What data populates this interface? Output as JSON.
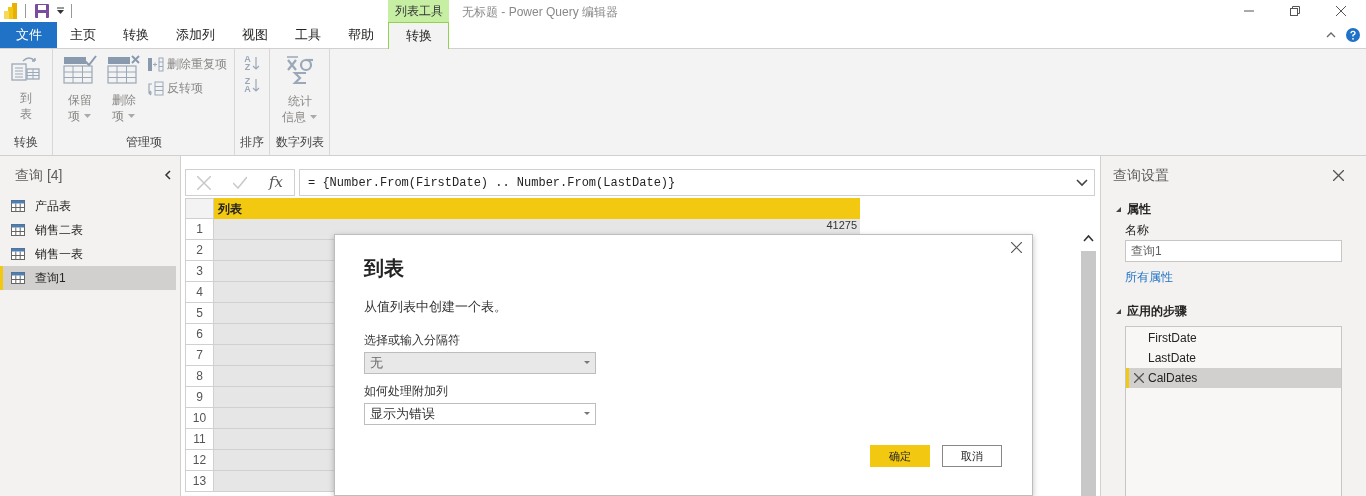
{
  "title_bar": {
    "context_group": "列表工具",
    "title": "无标题 - Power Query 编辑器"
  },
  "ribbon_tabs": [
    {
      "label": "文件",
      "kind": "file",
      "selected": false
    },
    {
      "label": "主页",
      "kind": "normal",
      "selected": false
    },
    {
      "label": "转换",
      "kind": "normal",
      "selected": false
    },
    {
      "label": "添加列",
      "kind": "normal",
      "selected": false
    },
    {
      "label": "视图",
      "kind": "normal",
      "selected": false
    },
    {
      "label": "工具",
      "kind": "normal",
      "selected": false
    },
    {
      "label": "帮助",
      "kind": "normal",
      "selected": false
    },
    {
      "label": "转换",
      "kind": "context",
      "selected": true
    }
  ],
  "ribbon_groups": [
    {
      "label": "转换",
      "buttons": [
        {
          "kind": "large",
          "lines": [
            "到",
            "表"
          ],
          "dropdown": false
        }
      ]
    },
    {
      "label": "管理项",
      "buttons": [
        {
          "kind": "large",
          "lines": [
            "保留",
            "项"
          ],
          "dropdown": true
        },
        {
          "kind": "large",
          "lines": [
            "删除",
            "项"
          ],
          "dropdown": true
        },
        {
          "kind": "small",
          "lines": [
            "删除重复项"
          ],
          "dropdown": false
        },
        {
          "kind": "small",
          "lines": [
            "反转项"
          ],
          "dropdown": false
        }
      ]
    },
    {
      "label": "排序",
      "buttons": [
        {
          "kind": "sort",
          "lines": [
            "A",
            "Z"
          ],
          "dropdown": false
        },
        {
          "kind": "sort",
          "lines": [
            "Z",
            "A"
          ],
          "dropdown": false
        }
      ]
    },
    {
      "label": "数字列表",
      "buttons": [
        {
          "kind": "large",
          "lines": [
            "统计",
            "信息"
          ],
          "dropdown": true
        }
      ]
    }
  ],
  "queries_pane": {
    "title": "查询 [4]",
    "items": [
      {
        "label": "产品表",
        "selected": false
      },
      {
        "label": "销售二表",
        "selected": false
      },
      {
        "label": "销售一表",
        "selected": false
      },
      {
        "label": "查询1",
        "selected": true
      }
    ]
  },
  "formula_bar": {
    "function_label": "fx",
    "formula": "= {Number.From(FirstDate) .. Number.From(LastDate)}"
  },
  "table": {
    "column": "列表",
    "rows": [
      {
        "number": "1",
        "value": "41275"
      },
      {
        "number": "2"
      },
      {
        "number": "3"
      },
      {
        "number": "4"
      },
      {
        "number": "5"
      },
      {
        "number": "6"
      },
      {
        "number": "7"
      },
      {
        "number": "8"
      },
      {
        "number": "9"
      },
      {
        "number": "10"
      },
      {
        "number": "11"
      },
      {
        "number": "12"
      },
      {
        "number": "13"
      }
    ]
  },
  "query_settings": {
    "title": "查询设置",
    "properties_heading": "属性",
    "name_label": "名称",
    "name_value": "查询1",
    "all_properties_link": "所有属性",
    "steps_heading": "应用的步骤",
    "steps": [
      {
        "label": "FirstDate",
        "selected": false
      },
      {
        "label": "LastDate",
        "selected": false
      },
      {
        "label": "CalDates",
        "selected": true
      }
    ]
  },
  "dialog": {
    "title": "到表",
    "description": "从值列表中创建一个表。",
    "fields": [
      {
        "label": "选择或输入分隔符",
        "value": "无",
        "disabled": true
      },
      {
        "label": "如何处理附加列",
        "value": "显示为错误",
        "disabled": false
      }
    ],
    "buttons": [
      {
        "label": "确定",
        "primary": true
      },
      {
        "label": "取消",
        "primary": false
      }
    ]
  }
}
